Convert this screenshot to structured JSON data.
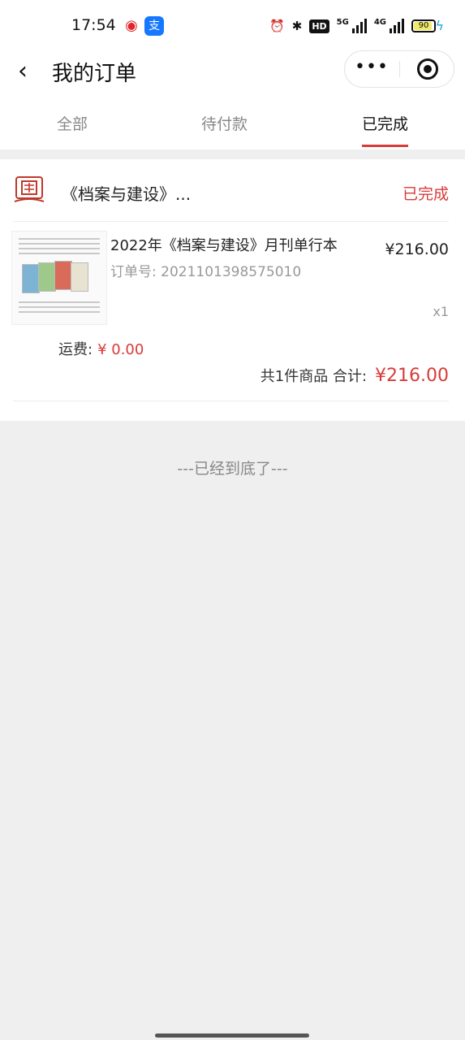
{
  "status_bar": {
    "time": "17:54",
    "apps": [
      "weibo-icon",
      "alipay-icon"
    ],
    "network": "5G",
    "network2": "4G",
    "battery": "90"
  },
  "nav": {
    "back_icon": "chevron-left-icon",
    "title": "我的订单",
    "more_icon": "more-dots-icon",
    "close_icon": "target-close-icon"
  },
  "tabs": [
    {
      "label": "全部"
    },
    {
      "label": "待付款"
    },
    {
      "label": "已完成"
    }
  ],
  "order": {
    "shop_name": "《档案与建设》...",
    "status": "已完成",
    "product_name": "2022年《档案与建设》月刊单行本",
    "order_no": "订单号: 2021101398575010",
    "price": "¥216.00",
    "quantity": "x1",
    "shipping_label": "运费:",
    "shipping_value": "¥ 0.00",
    "total_label": "共1件商品 合计:",
    "total_value": "¥216.00"
  },
  "end_text": "---已经到底了---",
  "colors": {
    "accent": "#d93a3a",
    "background": "#efefef"
  }
}
